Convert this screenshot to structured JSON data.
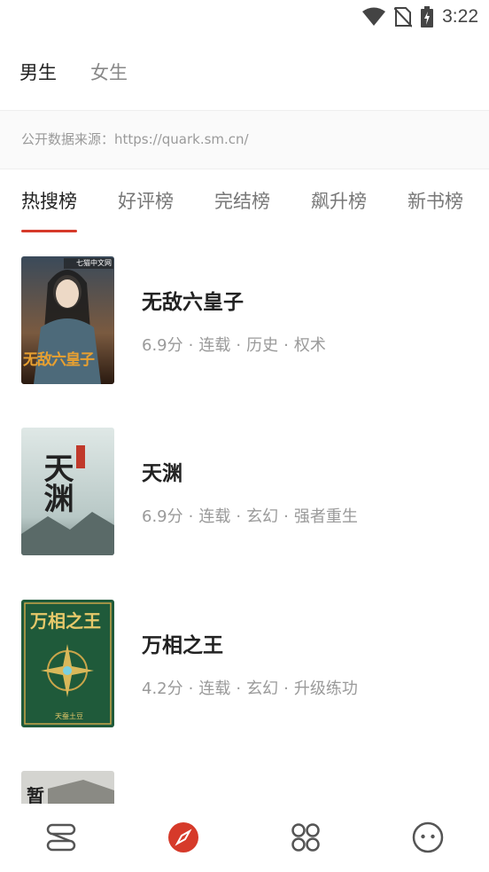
{
  "status_bar": {
    "time": "3:22",
    "icons": [
      "wifi-icon",
      "no-sim-icon",
      "battery-charging-icon"
    ]
  },
  "gender_tabs": [
    {
      "label": "男生",
      "active": true
    },
    {
      "label": "女生",
      "active": false
    }
  ],
  "source_notice": "公开数据来源：https://quark.sm.cn/",
  "rank_tabs": [
    {
      "label": "热搜榜",
      "active": true
    },
    {
      "label": "好评榜",
      "active": false
    },
    {
      "label": "完结榜",
      "active": false
    },
    {
      "label": "飙升榜",
      "active": false
    },
    {
      "label": "新书榜",
      "active": false
    }
  ],
  "books": [
    {
      "title": "无敌六皇子",
      "score": "6.9分",
      "status": "连载",
      "category": "历史",
      "tag": "权术",
      "cover_text": "无敌六皇子",
      "cover_badge": "七猫中文网",
      "cover_color": "#6b4a3a"
    },
    {
      "title": "天渊",
      "score": "6.9分",
      "status": "连载",
      "category": "玄幻",
      "tag": "强者重生",
      "cover_text": "天渊",
      "cover_color": "#cfd8d8"
    },
    {
      "title": "万相之王",
      "score": "4.2分",
      "status": "连载",
      "category": "玄幻",
      "tag": "升级练功",
      "cover_text": "万相之王",
      "cover_subtext": "天蚕土豆",
      "cover_color": "#1f5a3a"
    },
    {
      "title": "",
      "score": "",
      "status": "",
      "category": "",
      "tag": "",
      "cover_text": "暂",
      "cover_color": "#c9c9c9"
    }
  ],
  "bottom_nav": [
    {
      "name": "bookshelf",
      "icon": "bookshelf-icon",
      "active": false
    },
    {
      "name": "discover",
      "icon": "compass-icon",
      "active": true
    },
    {
      "name": "category",
      "icon": "grid-icon",
      "active": false
    },
    {
      "name": "profile",
      "icon": "smiley-icon",
      "active": false
    }
  ],
  "colors": {
    "accent": "#d63a2a",
    "text": "#222222",
    "muted": "#9a9a9a"
  }
}
